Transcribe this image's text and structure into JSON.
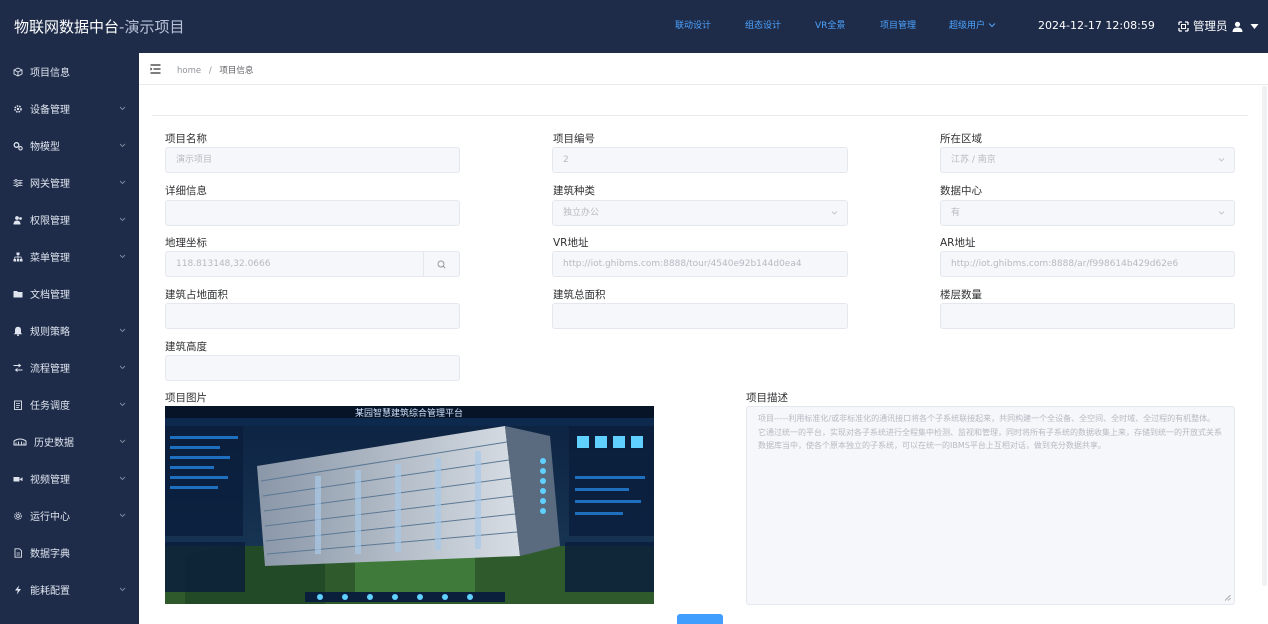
{
  "header": {
    "app_title": "物联网数据中台",
    "separator": "-",
    "project_name": "演示项目",
    "nav": [
      "联动设计",
      "组态设计",
      "VR全景",
      "项目管理",
      "超级用户"
    ],
    "datetime": "2024-12-17 12:08:59",
    "user_label": "管理员"
  },
  "sidebar": {
    "items": [
      {
        "label": "项目信息",
        "icon": "cube-icon"
      },
      {
        "label": "设备管理",
        "icon": "gear-icon"
      },
      {
        "label": "物模型",
        "icon": "gears-icon"
      },
      {
        "label": "网关管理",
        "icon": "sliders-icon"
      },
      {
        "label": "权限管理",
        "icon": "users-icon"
      },
      {
        "label": "菜单管理",
        "icon": "sitemap-icon"
      },
      {
        "label": "文档管理",
        "icon": "folder-icon"
      },
      {
        "label": "规则策略",
        "icon": "bell-icon"
      },
      {
        "label": "流程管理",
        "icon": "flow-icon"
      },
      {
        "label": "任务调度",
        "icon": "clipboard-icon"
      },
      {
        "label": "历史数据",
        "icon": "history-icon"
      },
      {
        "label": "视频管理",
        "icon": "video-icon"
      },
      {
        "label": "运行中心",
        "icon": "cog-icon"
      },
      {
        "label": "数据字典",
        "icon": "document-icon"
      },
      {
        "label": "能耗配置",
        "icon": "bolt-icon"
      }
    ]
  },
  "breadcrumb": {
    "home": "home",
    "separator": "/",
    "current": "项目信息"
  },
  "form": {
    "project_name": {
      "label": "项目名称",
      "value": "演示项目"
    },
    "project_code": {
      "label": "项目编号",
      "value": "2"
    },
    "region": {
      "label": "所在区域",
      "value": "江苏 / 南京"
    },
    "detail": {
      "label": "详细信息",
      "value": ""
    },
    "building_type": {
      "label": "建筑种类",
      "value": "独立办公"
    },
    "data_center": {
      "label": "数据中心",
      "value": "有"
    },
    "coordinates": {
      "label": "地理坐标",
      "value": "118.813148,32.0666"
    },
    "vr_url": {
      "label": "VR地址",
      "value": "http://iot.ghibms.com:8888/tour/4540e92b144d0ea4"
    },
    "ar_url": {
      "label": "AR地址",
      "value": "http://iot.ghibms.com:8888/ar/f998614b429d62e6"
    },
    "land_area": {
      "label": "建筑占地面积",
      "value": ""
    },
    "total_area": {
      "label": "建筑总面积",
      "value": ""
    },
    "floor_count": {
      "label": "楼层数量",
      "value": ""
    },
    "building_height": {
      "label": "建筑高度",
      "value": ""
    },
    "image_label": "项目图片",
    "description_label": "项目描述",
    "description": "项目-----利用标准化/或非标准化的通讯接口将各个子系统联接起来，共同构建一个全设备、全空间、全时域、全过程的有机整体。它通过统一的平台，实现对各子系统进行全程集中检测、监视和管理，同时将所有子系统的数据收集上来，存储到统一的开放式关系数据库当中，使各个原本独立的子系统，可以在统一的IBMS平台上互相对话，做到充分数据共享。",
    "image_banner": "某园智慧建筑综合管理平台"
  },
  "colors": {
    "header_bg": "#1e2c4a",
    "nav_link": "#4da3ff",
    "primary": "#409eff"
  }
}
